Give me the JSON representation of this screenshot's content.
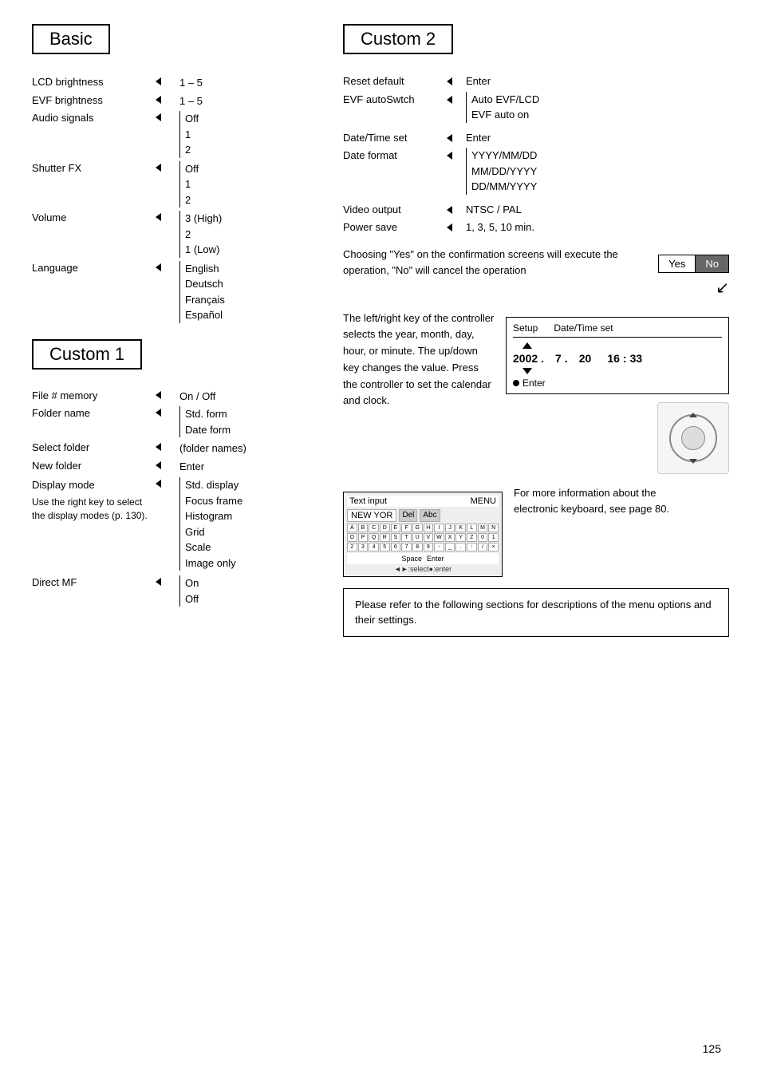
{
  "page_number": "125",
  "sections": {
    "basic": {
      "header": "Basic",
      "items": [
        {
          "label": "LCD brightness",
          "values": [
            "1 – 5"
          ]
        },
        {
          "label": "EVF brightness",
          "values": [
            "1 – 5"
          ]
        },
        {
          "label": "Audio signals",
          "values": [
            "Off",
            "1",
            "2"
          ]
        },
        {
          "label": "Shutter FX",
          "values": [
            "Off",
            "1",
            "2"
          ]
        },
        {
          "label": "Volume",
          "values": [
            "3 (High)",
            "2",
            "1 (Low)"
          ]
        },
        {
          "label": "Language",
          "values": [
            "English",
            "Deutsch",
            "Français",
            "Español"
          ]
        }
      ]
    },
    "custom1": {
      "header": "Custom 1",
      "items": [
        {
          "label": "File # memory",
          "values": [
            "On / Off"
          ]
        },
        {
          "label": "Folder name",
          "values": [
            "Std. form",
            "Date form"
          ]
        },
        {
          "label": "Select folder",
          "values": [
            "(folder names)"
          ]
        },
        {
          "label": "New folder",
          "values": [
            "Enter"
          ]
        },
        {
          "label": "Display mode",
          "values": [
            "Std. display",
            "Focus frame",
            "Histogram",
            "Grid",
            "Scale",
            "Image only"
          ]
        },
        {
          "label": "Direct MF",
          "values": [
            "On",
            "Off"
          ]
        }
      ]
    },
    "custom1_note": "Use the right key to select the display modes (p. 130).",
    "custom2": {
      "header": "Custom 2",
      "items": [
        {
          "label": "Reset default",
          "values": [
            "Enter"
          ]
        },
        {
          "label": "EVF autoSwtch",
          "values": [
            "Auto EVF/LCD",
            "EVF auto on"
          ]
        },
        {
          "label": "Date/Time set",
          "values": [
            "Enter"
          ]
        },
        {
          "label": "Date format",
          "values": [
            "YYYY/MM/DD",
            "MM/DD/YYYY",
            "DD/MM/YYYY"
          ]
        },
        {
          "label": "Video output",
          "values": [
            "NTSC / PAL"
          ]
        },
        {
          "label": "Power save",
          "values": [
            "1, 3, 5, 10 min."
          ]
        }
      ]
    }
  },
  "confirmation": {
    "text": "Choosing \"Yes\" on the confirmation screens will execute the operation, \"No\" will cancel the operation",
    "yes_label": "Yes",
    "no_label": "No"
  },
  "datetime_panel": {
    "header_left": "Setup",
    "header_right": "Date/Time set",
    "year": "2002",
    "sep1": ".",
    "month": "7",
    "sep2": ".",
    "day": "20",
    "time_sep": ":",
    "hour": "16",
    "minute": "33",
    "enter_label": "Enter"
  },
  "left_right_note": "The left/right key of the controller selects the year, month, day, hour, or minute. The up/down key changes the value. Press the controller to set the calendar and clock.",
  "keyboard_info": {
    "title": "Text input",
    "menu_label": "MENU",
    "input_text": "NEW YOR",
    "del_label": "Del",
    "abc_label": "Abc",
    "space_label": "Space",
    "enter_label": "Enter",
    "hint": "◄►:select●:enter"
  },
  "keyboard_note": "For more information about the electronic keyboard, see page 80.",
  "refer_note": "Please refer to the following sections for descriptions of the menu options and their settings."
}
